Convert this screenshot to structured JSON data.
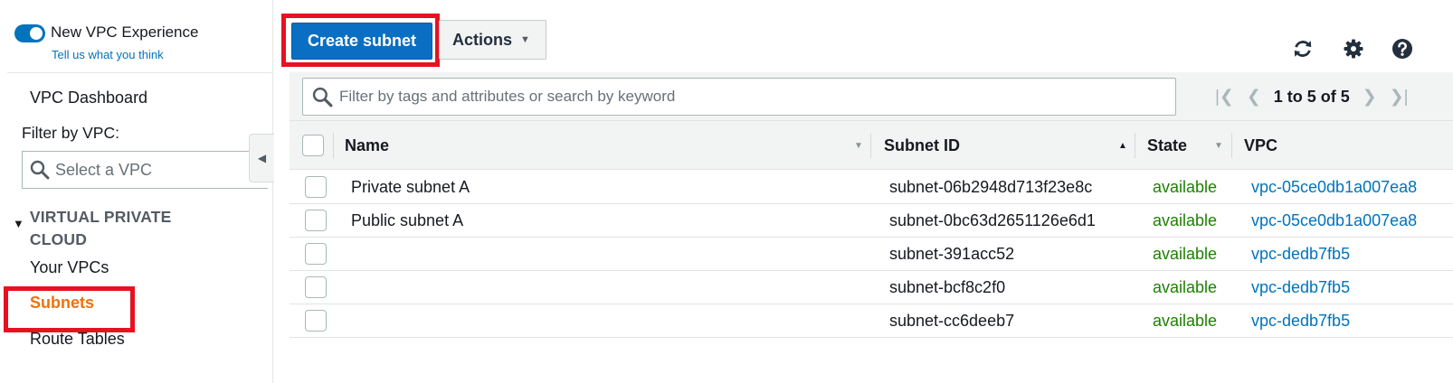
{
  "sidebar": {
    "toggle_label": "New VPC Experience",
    "feedback_link": "Tell us what you think",
    "dashboard": "VPC Dashboard",
    "filter_label": "Filter by VPC:",
    "vpc_select_placeholder": "Select a VPC",
    "section_title": "VIRTUAL PRIVATE CLOUD",
    "items": [
      {
        "label": "Your VPCs",
        "active": false
      },
      {
        "label": "Subnets",
        "active": true
      },
      {
        "label": "Route Tables",
        "active": false
      }
    ]
  },
  "toolbar": {
    "create_label": "Create subnet",
    "actions_label": "Actions",
    "icons": [
      "refresh-icon",
      "gear-icon",
      "help-icon"
    ]
  },
  "search": {
    "placeholder": "Filter by tags and attributes or search by keyword",
    "value": ""
  },
  "pagination": {
    "text": "1 to 5 of 5"
  },
  "table": {
    "columns": [
      "Name",
      "Subnet ID",
      "State",
      "VPC"
    ],
    "rows": [
      {
        "name": "Private subnet A",
        "subnet_id": "subnet-06b2948d713f23e8c",
        "state": "available",
        "vpc": "vpc-05ce0db1a007ea8"
      },
      {
        "name": "Public subnet A",
        "subnet_id": "subnet-0bc63d2651126e6d1",
        "state": "available",
        "vpc": "vpc-05ce0db1a007ea8"
      },
      {
        "name": "",
        "subnet_id": "subnet-391acc52",
        "state": "available",
        "vpc": "vpc-dedb7fb5"
      },
      {
        "name": "",
        "subnet_id": "subnet-bcf8c2f0",
        "state": "available",
        "vpc": "vpc-dedb7fb5"
      },
      {
        "name": "",
        "subnet_id": "subnet-cc6deeb7",
        "state": "available",
        "vpc": "vpc-dedb7fb5"
      }
    ]
  },
  "colors": {
    "primary": "#0a6fc2",
    "link": "#0073bb",
    "active_nav": "#ec7211",
    "state_available": "#1d8102",
    "highlight": "#e8111f"
  }
}
